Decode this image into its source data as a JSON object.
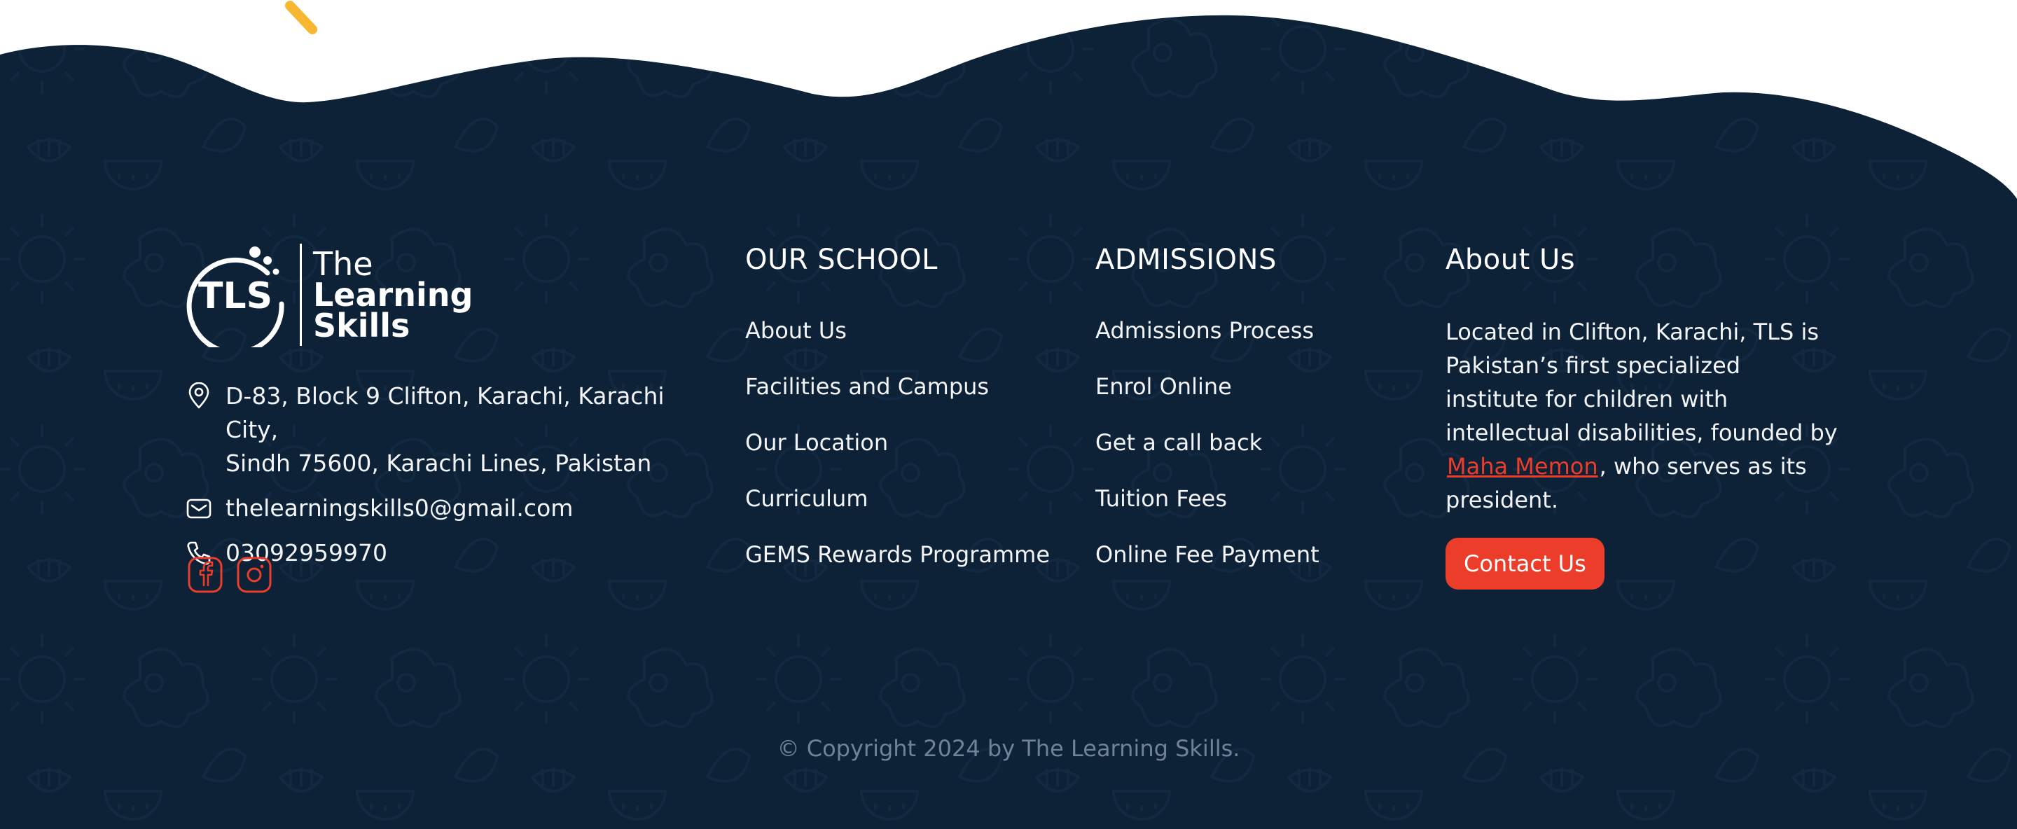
{
  "colors": {
    "footer_bg": "#0d2137",
    "accent": "#ec3d2a",
    "decor_yellow": "#f7b731",
    "text": "#f2f4f7",
    "muted": "#6f8298"
  },
  "brand": {
    "logo_mark_text": "TLS",
    "logo_line1": "The",
    "logo_line2": "Learning",
    "logo_line3": "Skills"
  },
  "contact": {
    "address_icon": "location-pin-icon",
    "address_line1": "D-83, Block 9 Clifton, Karachi, Karachi City,",
    "address_line2": "Sindh 75600, Karachi Lines, Pakistan",
    "email_icon": "mail-icon",
    "email": "thelearningskills0@gmail.com",
    "phone_icon": "phone-icon",
    "phone": "03092959970"
  },
  "socials": [
    {
      "icon": "facebook-icon"
    },
    {
      "icon": "instagram-icon"
    }
  ],
  "our_school": {
    "heading": "OUR SCHOOL",
    "links": [
      "About Us",
      "Facilities and Campus",
      "Our Location",
      "Curriculum",
      "GEMS Rewards Programme"
    ]
  },
  "admissions": {
    "heading": "ADMISSIONS",
    "links": [
      "Admissions Process",
      "Enrol Online",
      "Get a call back",
      "Tuition Fees",
      "Online Fee Payment"
    ]
  },
  "about": {
    "heading": "About Us",
    "text_before": "Located in Clifton, Karachi, TLS is Pakistan’s first specialized institute for children with intellectual disabilities, founded by",
    "founder_link": "Maha Memon",
    "text_after": ", who serves as its president.",
    "button": "Contact Us"
  },
  "copyright": "© Copyright 2024 by The Learning Skills."
}
